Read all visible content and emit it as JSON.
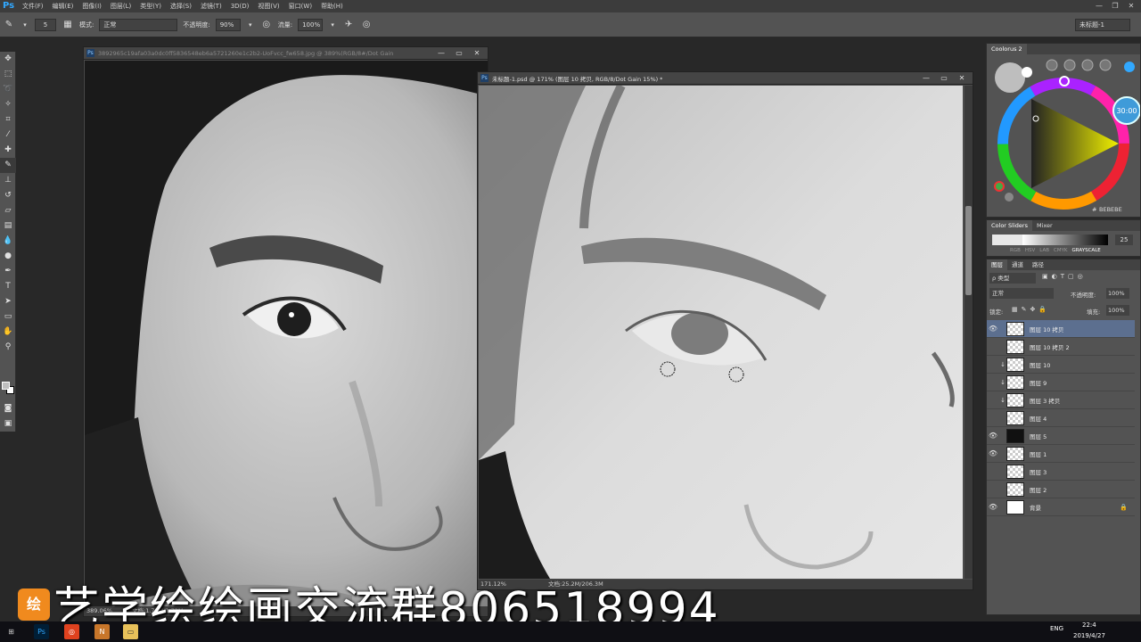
{
  "app": {
    "logo": "Ps",
    "menu": [
      "文件(F)",
      "编辑(E)",
      "图像(I)",
      "图层(L)",
      "类型(Y)",
      "选择(S)",
      "滤镜(T)",
      "3D(D)",
      "视图(V)",
      "窗口(W)",
      "帮助(H)"
    ],
    "window_controls": [
      "—",
      "❐",
      "✕"
    ]
  },
  "options_bar": {
    "brush_size": "5",
    "mode_label": "模式:",
    "mode_value": "正常",
    "opacity_label": "不透明度:",
    "opacity_value": "90%",
    "flow_label": "流量:",
    "flow_value": "100%",
    "workspace": "未标题-1"
  },
  "tools": [
    "move-tool",
    "marquee-tool",
    "lasso-tool",
    "quick-select-tool",
    "crop-tool",
    "eyedropper-tool",
    "healing-tool",
    "brush-tool",
    "stamp-tool",
    "history-brush-tool",
    "eraser-tool",
    "gradient-tool",
    "blur-tool",
    "dodge-tool",
    "pen-tool",
    "type-tool",
    "path-select-tool",
    "shape-tool",
    "hand-tool",
    "zoom-tool"
  ],
  "documents": [
    {
      "title": "3892965c19afa03a0dc0ff5836548eb6a5721260e1c2b2-UoFvcc_fw658.jpg @ 389%(RGB/8#/Dot Gain",
      "zoom": "389.06%",
      "doc_info": "文档:1.72M/1.72M"
    },
    {
      "title": "未标题-1.psd @ 171% (图层 10 拷贝, RGB/8/Dot Gain 15%) *",
      "zoom": "171.12%",
      "doc_info": "文档:25.2M/206.3M"
    }
  ],
  "coolorus": {
    "panel_title": "Coolorus 2",
    "hue_readout": "30:00",
    "hex": "BEBEBE"
  },
  "color_sliders": {
    "tabs": [
      "Color Sliders",
      "Mixer"
    ],
    "value": "25",
    "modes": [
      "RGB",
      "HSV",
      "LAB",
      "CMYK",
      "GRAYSCALE"
    ],
    "active_mode": "GRAYSCALE"
  },
  "layers_panel": {
    "tabs": [
      "图层",
      "通道",
      "路径"
    ],
    "kind_filter": "ρ 类型",
    "blend_mode": "正常",
    "opacity_label": "不透明度:",
    "opacity_value": "100%",
    "lock_label": "锁定:",
    "fill_label": "填充:",
    "fill_value": "100%",
    "layers": [
      {
        "name": "图层 10 拷贝",
        "visible": true,
        "selected": true,
        "clipped": false
      },
      {
        "name": "图层 10 拷贝 2",
        "visible": false,
        "selected": false,
        "clipped": false
      },
      {
        "name": "图层 10",
        "visible": false,
        "selected": false,
        "clipped": true
      },
      {
        "name": "图层 9",
        "visible": false,
        "selected": false,
        "clipped": true
      },
      {
        "name": "图层 3 拷贝",
        "visible": false,
        "selected": false,
        "clipped": true
      },
      {
        "name": "图层 4",
        "visible": false,
        "selected": false,
        "clipped": false
      },
      {
        "name": "图层 5",
        "visible": true,
        "selected": false,
        "clipped": false
      },
      {
        "name": "图层 1",
        "visible": true,
        "selected": false,
        "clipped": false
      },
      {
        "name": "图层 3",
        "visible": false,
        "selected": false,
        "clipped": false
      },
      {
        "name": "图层 2",
        "visible": false,
        "selected": false,
        "clipped": false
      },
      {
        "name": "背景",
        "visible": true,
        "selected": false,
        "clipped": false
      }
    ]
  },
  "watermark": {
    "logo_text": "绘",
    "text": "艺学绘绘画交流群806518994"
  },
  "taskbar": {
    "language": "ENG",
    "time": "22:4",
    "date": "2019/4/27"
  }
}
